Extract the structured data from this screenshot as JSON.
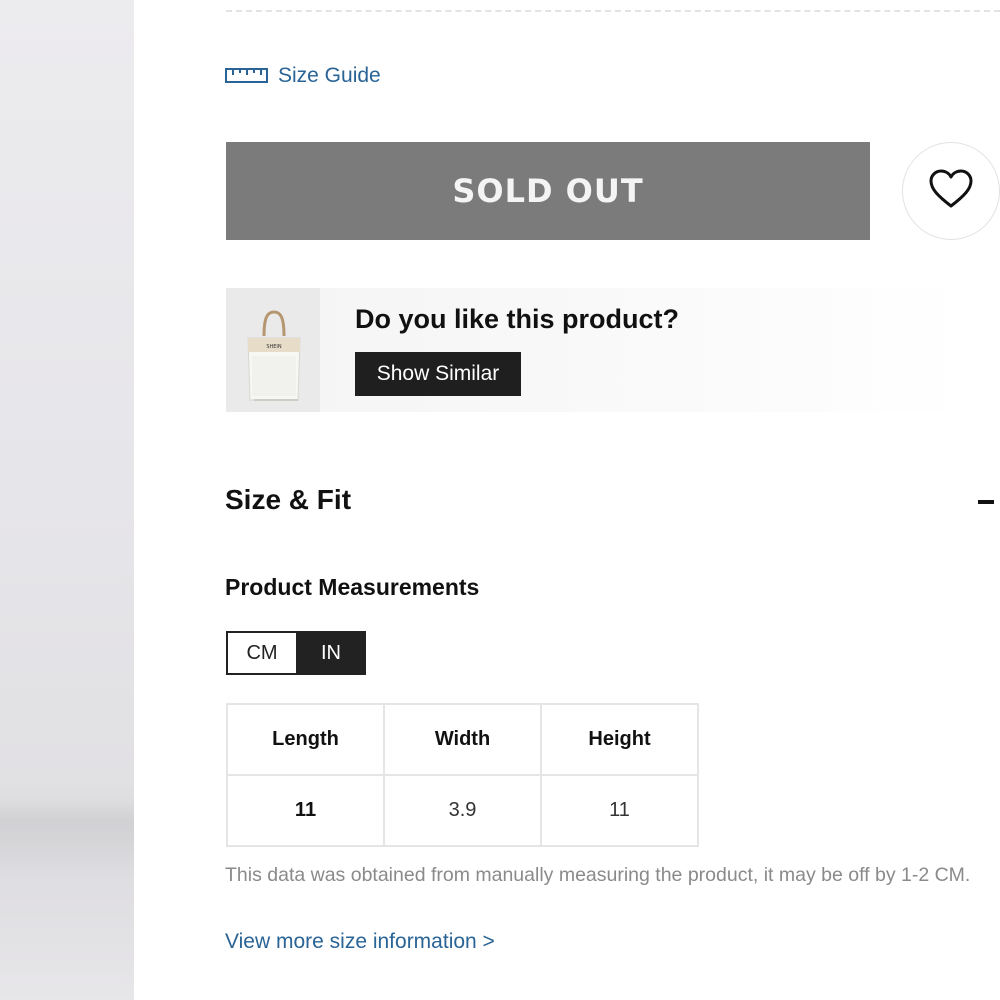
{
  "size_guide": {
    "label": "Size Guide",
    "icon": "ruler-icon"
  },
  "purchase": {
    "button_label": "SOLD OUT",
    "wishlist_icon": "heart-icon"
  },
  "similar": {
    "title": "Do you like this product?",
    "button_label": "Show Similar",
    "thumbnail_brand": "SHEIN"
  },
  "size_fit": {
    "title": "Size & Fit",
    "collapse_icon": "minus-icon"
  },
  "measurements": {
    "title": "Product Measurements",
    "units": [
      "CM",
      "IN"
    ],
    "selected_unit": "IN",
    "headers": [
      "Length",
      "Width",
      "Height"
    ],
    "values": [
      "11",
      "3.9",
      "11"
    ]
  },
  "note": "This data was obtained from manually measuring the product, it may be off by 1-2 CM.",
  "more_link": "View more size information >",
  "colors": {
    "link": "#2a6496",
    "soldout_bg": "#7b7b7b",
    "dark_button": "#1f1f1f"
  }
}
